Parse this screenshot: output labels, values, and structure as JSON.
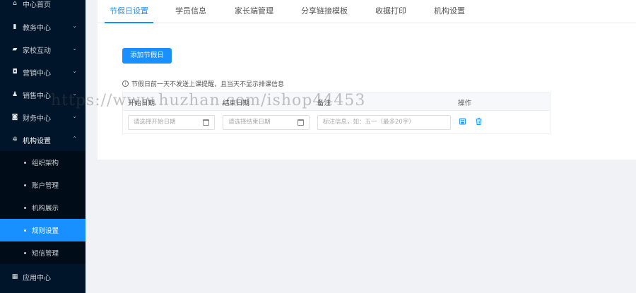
{
  "sidebar": {
    "items": [
      {
        "label": "中心首页",
        "icon": "home-icon",
        "glyph": "⌂",
        "expandable": false
      },
      {
        "label": "教务中心",
        "icon": "book-icon",
        "glyph": "▮",
        "expandable": true
      },
      {
        "label": "家校互动",
        "icon": "chat-icon",
        "glyph": "▰",
        "expandable": true
      },
      {
        "label": "营销中心",
        "icon": "bag-icon",
        "glyph": "◘",
        "expandable": true
      },
      {
        "label": "销售中心",
        "icon": "users-icon",
        "glyph": "♟",
        "expandable": true
      },
      {
        "label": "财务中心",
        "icon": "wallet-icon",
        "glyph": "◙",
        "expandable": true
      },
      {
        "label": "机构设置",
        "icon": "gear-icon",
        "glyph": "✲",
        "expandable": true,
        "expanded": true
      }
    ],
    "sub_items": [
      {
        "label": "组织架构",
        "active": false
      },
      {
        "label": "账户管理",
        "active": false
      },
      {
        "label": "机构展示",
        "active": false
      },
      {
        "label": "规则设置",
        "active": true
      },
      {
        "label": "短信管理",
        "active": false
      }
    ],
    "last_item": {
      "label": "应用中心",
      "icon": "grid-icon",
      "glyph": "▦"
    }
  },
  "tabs": [
    {
      "label": "节假日设置",
      "active": true
    },
    {
      "label": "学员信息",
      "active": false
    },
    {
      "label": "家长端管理",
      "active": false
    },
    {
      "label": "分享链接模板",
      "active": false
    },
    {
      "label": "收据打印",
      "active": false
    },
    {
      "label": "机构设置",
      "active": false
    }
  ],
  "add_button": "添加节假日",
  "notice": "节假日前一天不发送上课提醒，且当天不显示排课信息",
  "table": {
    "headers": [
      "开始日期",
      "结束日期",
      "备注",
      "操作"
    ],
    "row": {
      "start_placeholder": "请选择开始日期",
      "end_placeholder": "请选择结束日期",
      "note_placeholder": "标注信息，如：五一（最多20字）"
    }
  },
  "watermark": "https://www.huzhan.com/ishop44453",
  "colors": {
    "primary": "#1890ff",
    "sidebar_bg": "#001529"
  }
}
